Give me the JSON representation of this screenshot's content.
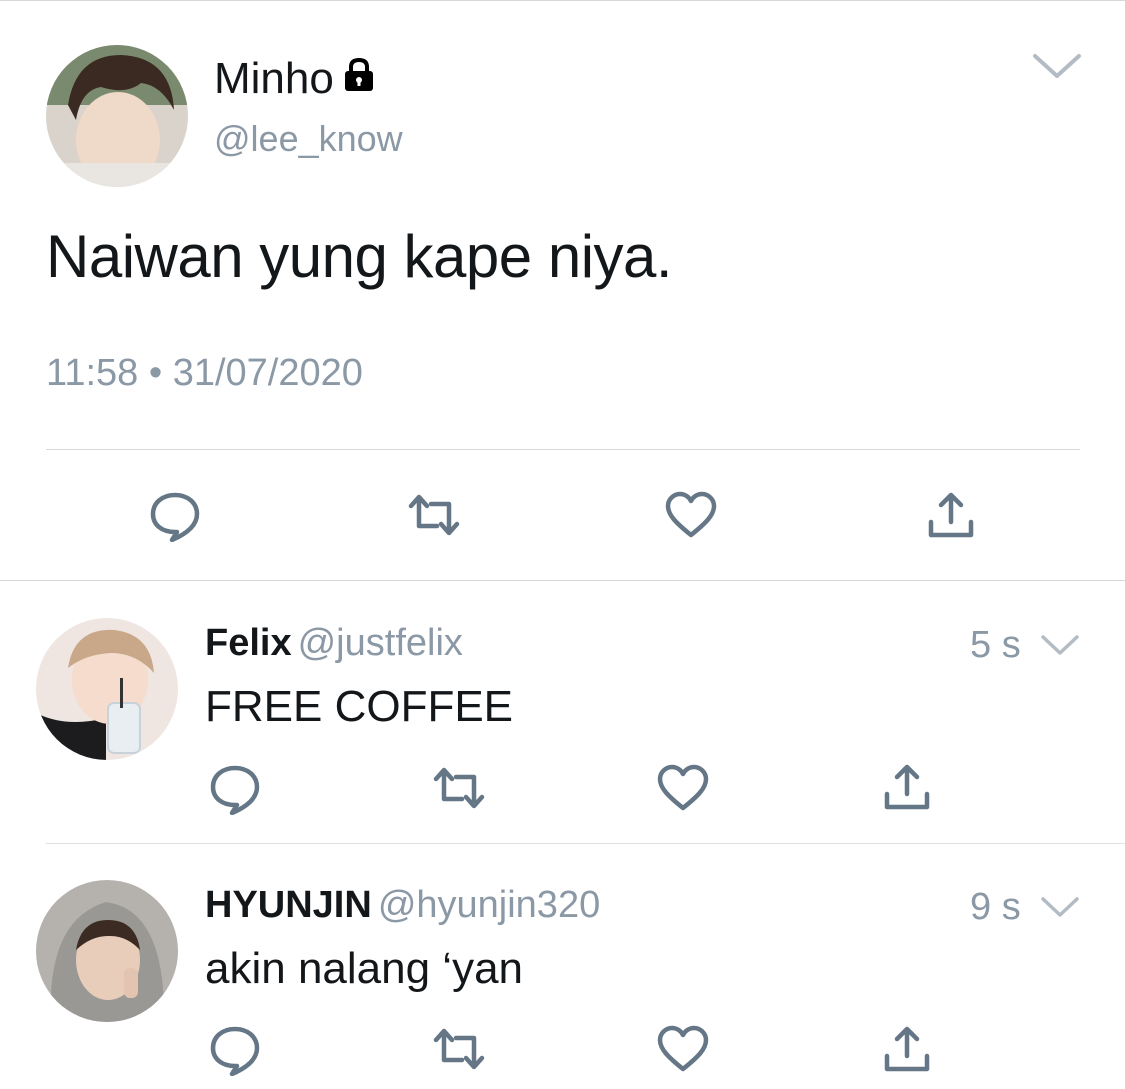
{
  "main_tweet": {
    "display_name": "Minho",
    "handle": "@lee_know",
    "text": "Naiwan yung kape niya.",
    "timestamp": "11:58 • 31/07/2020",
    "locked": true
  },
  "replies": [
    {
      "display_name": "Felix",
      "handle": "@justfelix",
      "time_ago": "5 s",
      "text": "FREE COFFEE"
    },
    {
      "display_name": "HYUNJIN",
      "handle": "@hyunjin320",
      "time_ago": "9 s",
      "text": "akin nalang ‘yan"
    }
  ],
  "icons": {
    "reply": "reply-icon",
    "retweet": "retweet-icon",
    "like": "heart-icon",
    "share": "share-icon",
    "caret": "chevron-down-icon",
    "lock": "lock-icon"
  },
  "colors": {
    "text_primary": "#14171a",
    "text_secondary": "#8b98a5",
    "icon_gray": "#657786",
    "divider": "#d8d8d8"
  }
}
